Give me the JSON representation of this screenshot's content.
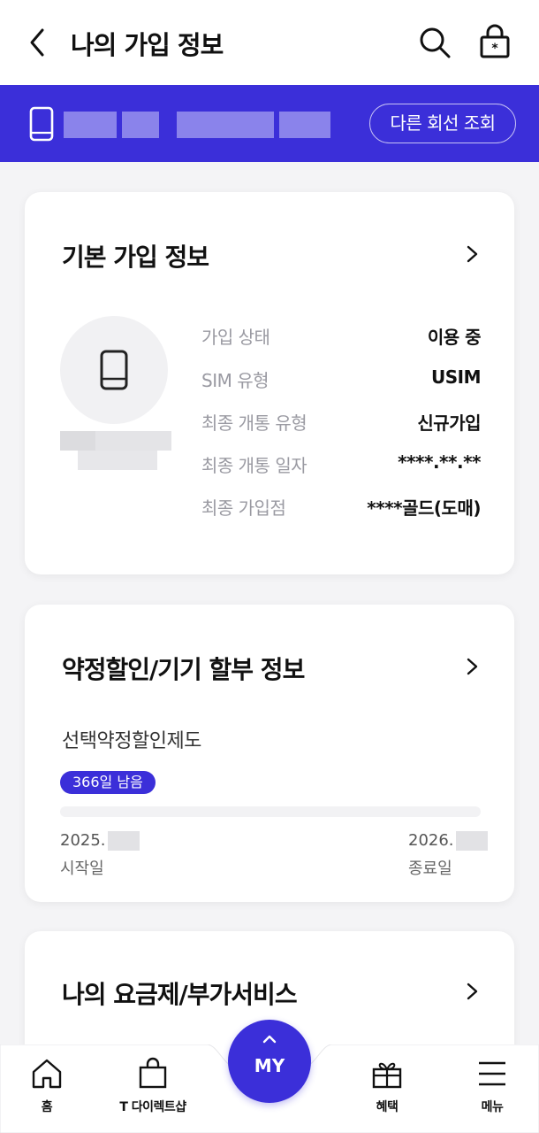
{
  "header": {
    "title": "나의 가입 정보"
  },
  "line_band": {
    "other_line_button": "다른 회선 조회"
  },
  "basic_info": {
    "title": "기본 가입 정보",
    "rows": [
      {
        "key": "가입 상태",
        "value": "이용 중"
      },
      {
        "key": "SIM 유형",
        "value": "USIM"
      },
      {
        "key": "최종 개통 유형",
        "value": "신규가입"
      },
      {
        "key": "최종 개통 일자",
        "value": "****.**.**"
      },
      {
        "key": "최종 가입점",
        "value": "****골드(도매)"
      }
    ]
  },
  "contract_info": {
    "title": "약정할인/기기 할부 정보",
    "plan_name": "선택약정할인제도",
    "days_left_badge": "366일 남음",
    "progress_fraction": 0.0,
    "start_date_prefix": "2025.",
    "end_date_prefix": "2026.",
    "start_label": "시작일",
    "end_label": "종료일"
  },
  "plan_info": {
    "title": "나의 요금제/부가서비스"
  },
  "bottom_nav": {
    "home": "홈",
    "tdirect": "T 다이렉트샵",
    "my": "MY",
    "benefits": "혜택",
    "menu": "메뉴"
  },
  "colors": {
    "accent": "#3b2fd9",
    "page_bg": "#f4f4f6"
  }
}
